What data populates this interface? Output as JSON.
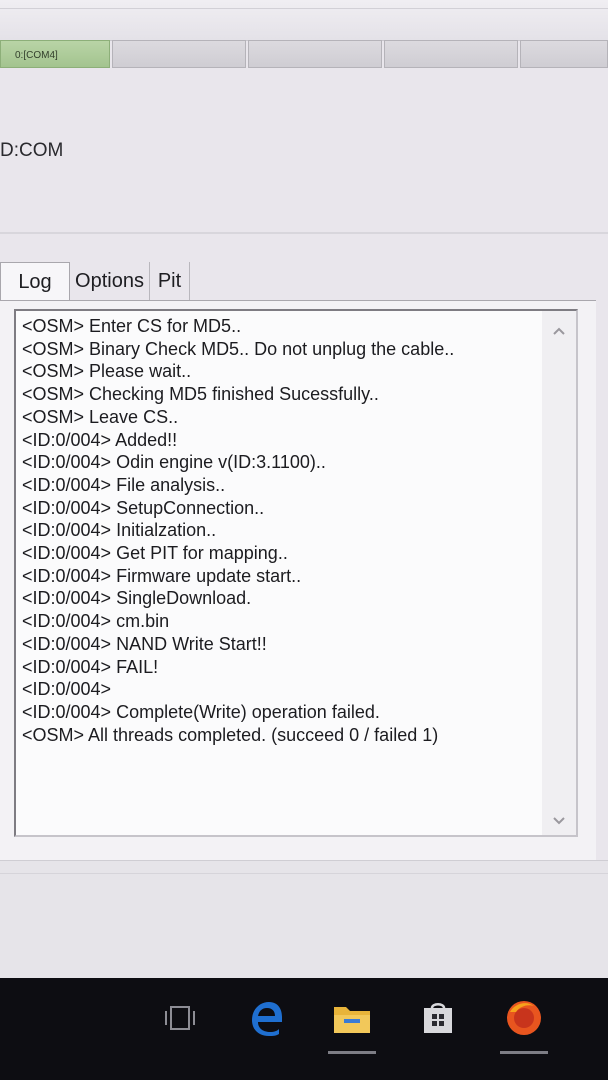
{
  "header": {
    "id_com_tab": "0:[COM4]",
    "id_com_label": "D:COM"
  },
  "tabs": [
    {
      "label": "Log",
      "active": true
    },
    {
      "label": "Options",
      "active": false
    },
    {
      "label": "Pit",
      "active": false
    }
  ],
  "log": {
    "lines": [
      "<OSM> Enter CS for MD5..",
      "<OSM> Binary Check MD5.. Do not unplug the cable..",
      "<OSM> Please wait..",
      "<OSM> Checking MD5 finished Sucessfully..",
      "<OSM> Leave CS..",
      "<ID:0/004> Added!!",
      "<ID:0/004> Odin engine v(ID:3.1100)..",
      "<ID:0/004> File analysis..",
      "<ID:0/004> SetupConnection..",
      "<ID:0/004> Initialzation..",
      "<ID:0/004> Get PIT for mapping..",
      "<ID:0/004> Firmware update start..",
      "<ID:0/004> SingleDownload.",
      "<ID:0/004> cm.bin",
      "<ID:0/004> NAND Write Start!!",
      "<ID:0/004> FAIL!",
      "<ID:0/004>",
      "<ID:0/004> Complete(Write) operation failed.",
      "<OSM> All threads completed. (succeed 0 / failed 1)"
    ]
  },
  "taskbar": {
    "icons": [
      "task-view-icon",
      "edge-icon",
      "file-explorer-icon",
      "store-icon",
      "firefox-icon"
    ]
  },
  "colors": {
    "active_com_tab": "#a3c48f",
    "taskbar": "#0d0d12",
    "edge": "#1f6fd0",
    "folder": "#e8b43a",
    "firefox": "#e8551f"
  }
}
